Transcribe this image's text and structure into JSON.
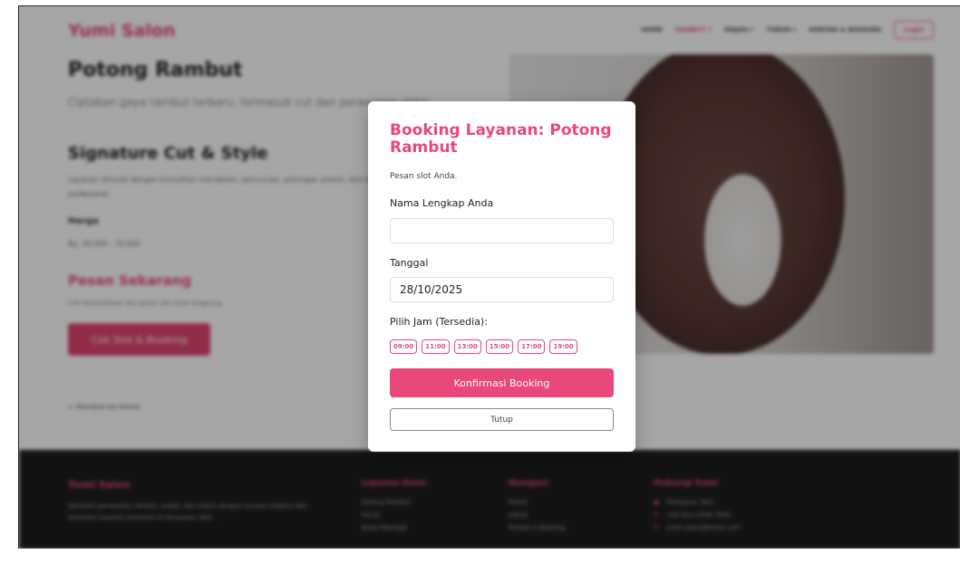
{
  "brand": "Yumi Salon",
  "nav": {
    "home": "HOME",
    "rambut": "RAMBUT ▾",
    "wajah": "WAJAH ▾",
    "tubuh": "TUBUH ▾",
    "kontak": "KONTAK & BOOKING",
    "login": "Login"
  },
  "service": {
    "title": "Potong Rambut",
    "desc": "Ciptakan gaya rambut terbaru, termasuk cut dan perawatan akhir.",
    "sig_title": "Signature Cut & Style",
    "sig_desc": "Layanan dimulai dengan konsultasi mendalam, pencucian, potongan presisi, dan diakhiri dengan penataan profesional.",
    "price_label": "Harga",
    "price_value": "Rp. 40.000 - 70.000",
    "order_title": "Pesan Sekarang",
    "order_desc": "Cek ketersediaan dan pesan slot Anda langsung.",
    "order_button": "Cek Slot & Booking",
    "back_link": "← Kembali ke Home"
  },
  "footer": {
    "brand": "Yumi Salon",
    "desc": "Spesialis perawatan rambut, wajah, dan tubuh dengan inovasi modern dan sentuhan layanan premium di Denpasar, Bali.",
    "col1": {
      "title": "Layanan Kami",
      "items": [
        "Potong Rambut",
        "Facial",
        "Body Massage"
      ]
    },
    "col2": {
      "title": "Navigasi",
      "items": [
        "Home",
        "Lokasi",
        "Kontak & Booking"
      ]
    },
    "col3": {
      "title": "Hubungi Kami",
      "items": [
        "Denpasar, Bali",
        "+62 812-3456-7890",
        "yumi.salon@email.com"
      ]
    }
  },
  "modal": {
    "title": "Booking Layanan: Potong Rambut",
    "subtitle": "Pesan slot Anda.",
    "name_label": "Nama Lengkap Anda",
    "name_value": "",
    "date_label": "Tanggal",
    "date_value": "28/10/2025",
    "time_label": "Pilih Jam (Tersedia):",
    "slots": [
      "09:00",
      "11:00",
      "13:00",
      "15:00",
      "17:00",
      "19:00"
    ],
    "confirm": "Konfirmasi Booking",
    "close": "Tutup"
  },
  "colors": {
    "accent": "#e8497a",
    "footer_bg": "#1e1e1e"
  }
}
